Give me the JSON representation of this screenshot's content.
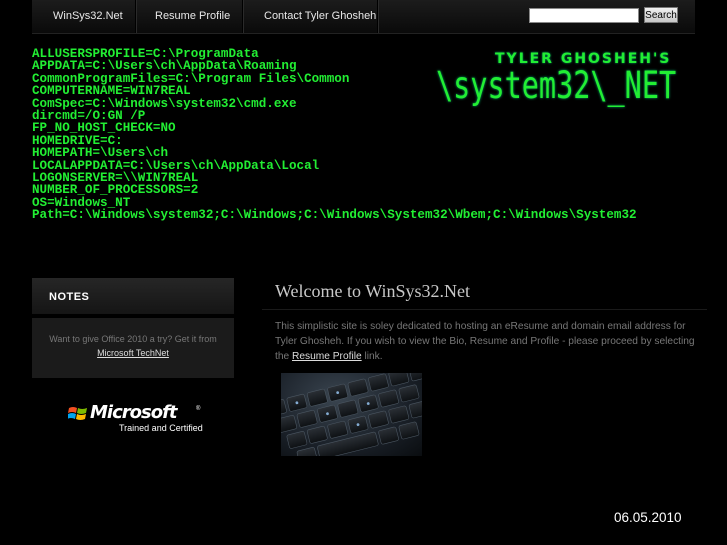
{
  "nav": {
    "items": [
      {
        "label": "WinSys32.Net"
      },
      {
        "label": "Resume Profile"
      },
      {
        "label": "Contact Tyler Ghosheh"
      }
    ],
    "search": {
      "value": "",
      "button_label": "Search"
    }
  },
  "env_vars": [
    "ALLUSERSPROFILE=C:\\ProgramData",
    "APPDATA=C:\\Users\\ch\\AppData\\Roaming",
    "CommonProgramFiles=C:\\Program Files\\Common",
    "COMPUTERNAME=WIN7REAL",
    "ComSpec=C:\\Windows\\system32\\cmd.exe",
    "dircmd=/O:GN /P",
    "FP_NO_HOST_CHECK=NO",
    "HOMEDRIVE=C:",
    "HOMEPATH=\\Users\\ch",
    "LOCALAPPDATA=C:\\Users\\ch\\AppData\\Local",
    "LOGONSERVER=\\\\WIN7REAL",
    "NUMBER_OF_PROCESSORS=2",
    "OS=Windows_NT",
    "Path=C:\\Windows\\system32;C:\\Windows;C:\\Windows\\System32\\Wbem;C:\\Windows\\System32"
  ],
  "logo": {
    "top": "TYLER GHOSHEH'S",
    "main": "\\system32\\_NET"
  },
  "sidebar": {
    "notes_title": "NOTES",
    "notes_text": "Want to give Office 2010 a try? Get it from",
    "notes_link": "Microsoft TechNet",
    "badge_wordmark": "Microsoft",
    "badge_tm": "®",
    "badge_sub": "Trained and Certified"
  },
  "main": {
    "title": "Welcome to WinSys32.Net",
    "para_before": "This simplistic site is soley dedicated to hosting an eResume and domain email address for Tyler Ghosheh. If you wish to view the Bio, Resume and Profile - please proceed by selecting the ",
    "para_link": "Resume Profile",
    "para_after": " link."
  },
  "footer": {
    "date": "06.05.2010"
  },
  "colors": {
    "terminal_green": "#22ee33",
    "background": "#000000"
  }
}
